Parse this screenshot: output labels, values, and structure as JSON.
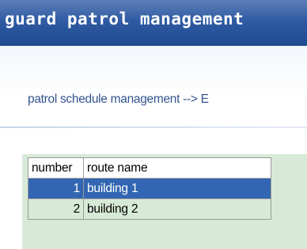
{
  "window": {
    "title": "guard patrol management"
  },
  "breadcrumb": {
    "text": "patrol schedule management  -->  E"
  },
  "grid": {
    "columns": [
      "number",
      "route name"
    ],
    "rows": [
      {
        "number": "1",
        "route_name": "building 1",
        "selected": true
      },
      {
        "number": "2",
        "route_name": "building 2",
        "selected": false
      }
    ]
  },
  "colors": {
    "titlebar": "#2f5ba3",
    "selected_row": "#3366b2",
    "panel_background": "#d7ead7",
    "breadcrumb_text": "#34558e"
  }
}
